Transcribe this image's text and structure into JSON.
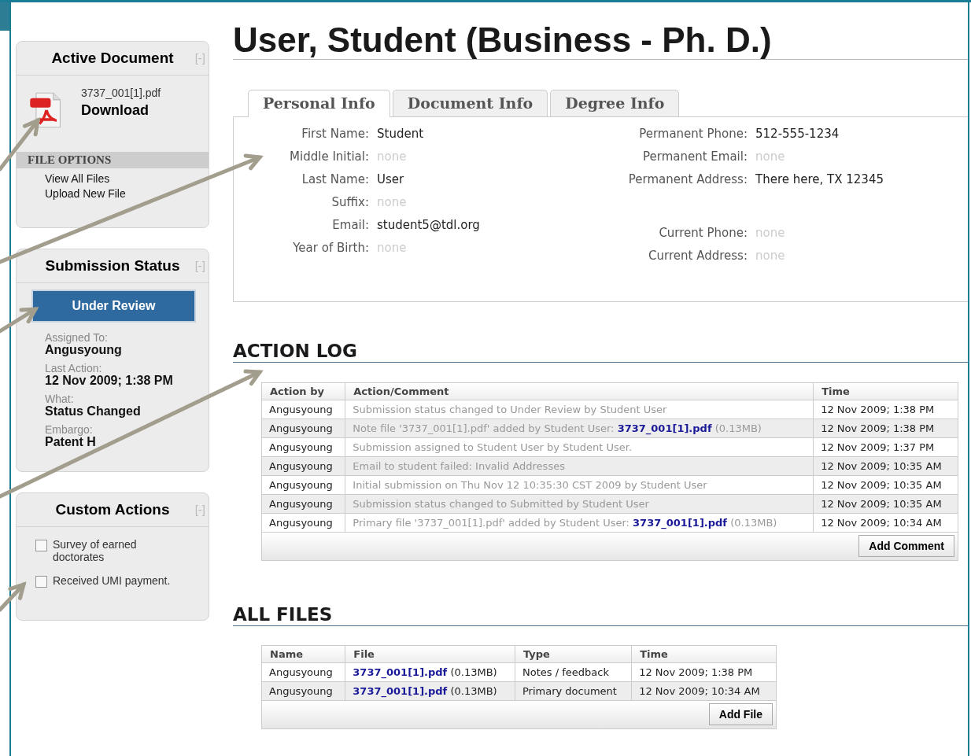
{
  "sidebar": {
    "active_document": {
      "title": "Active Document",
      "collapse": "[-]",
      "file_name": "3737_001[1].pdf",
      "download": "Download",
      "options_heading": "FILE OPTIONS",
      "options": [
        "View All Files",
        "Upload New File"
      ]
    },
    "submission_status": {
      "title": "Submission Status",
      "collapse": "[-]",
      "status": "Under Review",
      "details": [
        {
          "label": "Assigned To:",
          "value": "Angusyoung"
        },
        {
          "label": "Last Action:",
          "value": "12 Nov 2009; 1:38 PM"
        },
        {
          "label": "What:",
          "value": "Status Changed"
        },
        {
          "label": "Embargo:",
          "value": "Patent H"
        }
      ]
    },
    "custom_actions": {
      "title": "Custom Actions",
      "collapse": "[-]",
      "items": [
        {
          "label": "Survey of earned doctorates",
          "checked": false
        },
        {
          "label": "Received UMI payment.",
          "checked": false
        }
      ]
    }
  },
  "title": "User, Student (Business - Ph. D.)",
  "tabs": [
    {
      "label": "Personal Info",
      "selected": true
    },
    {
      "label": "Document Info",
      "selected": false
    },
    {
      "label": "Degree Info",
      "selected": false
    }
  ],
  "personal_info": {
    "left_fields": [
      {
        "label": "First Name:",
        "value": "Student",
        "empty": false
      },
      {
        "label": "Middle Initial:",
        "value": "none",
        "empty": true
      },
      {
        "label": "Last Name:",
        "value": "User",
        "empty": false
      },
      {
        "label": "Suffix:",
        "value": "none",
        "empty": true
      },
      {
        "label": "Email:",
        "value": "student5@tdl.org",
        "empty": false
      },
      {
        "label": "Year of Birth:",
        "value": "none",
        "empty": true
      }
    ],
    "permanent_fields": [
      {
        "label": "Permanent Phone:",
        "value": "512-555-1234",
        "empty": false
      },
      {
        "label": "Permanent Email:",
        "value": "none",
        "empty": true
      },
      {
        "label": "Permanent Address:",
        "value": "There here, TX 12345",
        "empty": false
      }
    ],
    "current_fields": [
      {
        "label": "Current Phone:",
        "value": "none",
        "empty": true
      },
      {
        "label": "Current Address:",
        "value": "none",
        "empty": true
      }
    ]
  },
  "action_log": {
    "heading": "ACTION LOG",
    "columns": [
      "Action by",
      "Action/Comment",
      "Time"
    ],
    "rows": [
      {
        "by": "Angusyoung",
        "comment": "Submission status changed to Under Review by Student User",
        "time": "12 Nov 2009; 1:38 PM"
      },
      {
        "by": "Angusyoung",
        "comment": "Note file '3737_001[1].pdf' added by Student User:",
        "link": "3737_001[1].pdf",
        "size": "(0.13MB)",
        "time": "12 Nov 2009; 1:38 PM"
      },
      {
        "by": "Angusyoung",
        "comment": "Submission assigned to Student User by Student User.",
        "time": "12 Nov 2009; 1:37 PM"
      },
      {
        "by": "Angusyoung",
        "comment": "Email to student failed: Invalid Addresses",
        "time": "12 Nov 2009; 10:35 AM"
      },
      {
        "by": "Angusyoung",
        "comment": "Initial submission on Thu Nov 12 10:35:30 CST 2009 by Student User",
        "time": "12 Nov 2009; 10:35 AM"
      },
      {
        "by": "Angusyoung",
        "comment": "Submission status changed to Submitted by Student User",
        "time": "12 Nov 2009; 10:35 AM"
      },
      {
        "by": "Angusyoung",
        "comment": "Primary file '3737_001[1].pdf' added by Student User:",
        "link": "3737_001[1].pdf",
        "size": "(0.13MB)",
        "time": "12 Nov 2009; 10:34 AM"
      }
    ],
    "button": "Add Comment"
  },
  "all_files": {
    "heading": "ALL FILES",
    "columns": [
      "Name",
      "File",
      "Type",
      "Time"
    ],
    "rows": [
      {
        "name": "Angusyoung",
        "file": "3737_001[1].pdf",
        "size": "(0.13MB)",
        "type": "Notes / feedback",
        "time": "12 Nov 2009; 1:38 PM"
      },
      {
        "name": "Angusyoung",
        "file": "3737_001[1].pdf",
        "size": "(0.13MB)",
        "type": "Primary document",
        "time": "12 Nov 2009; 10:34 AM"
      }
    ],
    "button": "Add File"
  }
}
